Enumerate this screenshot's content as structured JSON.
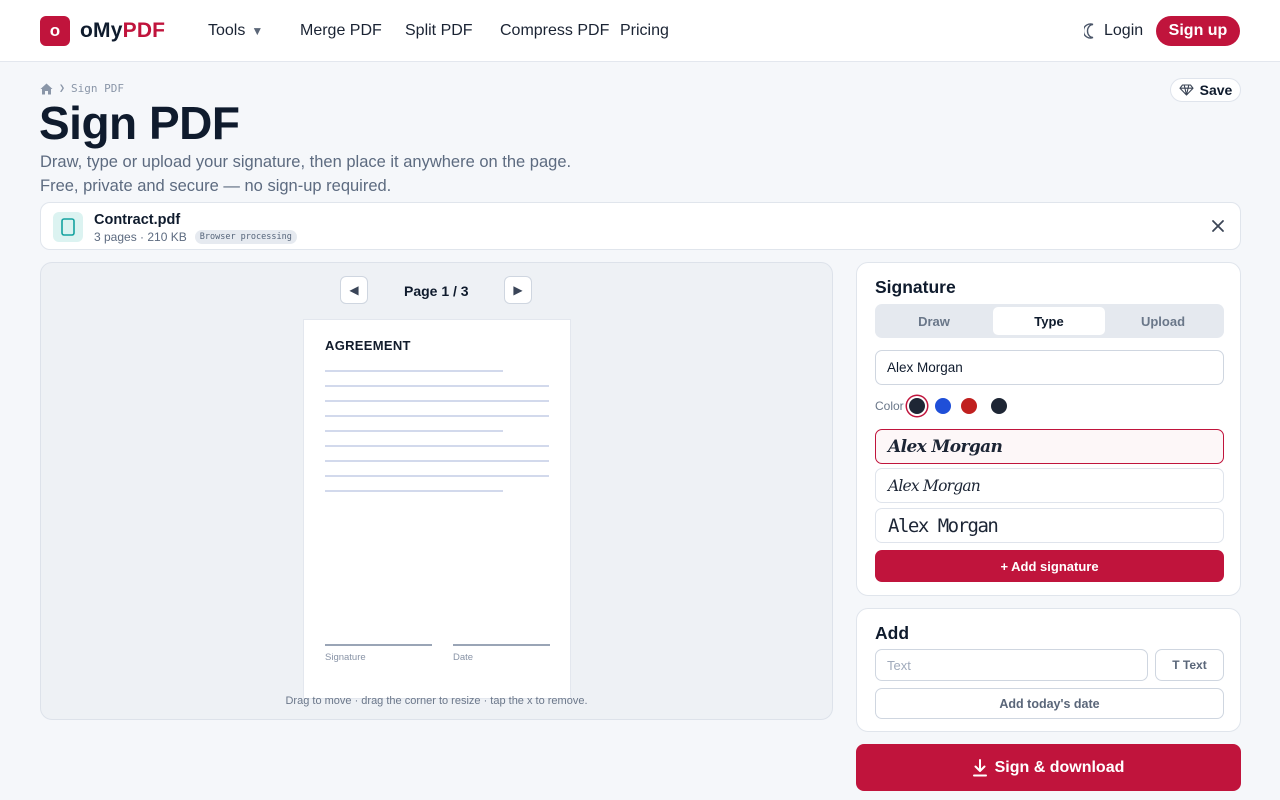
{
  "brand": {
    "logo_letter": "o",
    "name_part1": "oMy",
    "name_part2": "PDF",
    "accent_color": "#c0143c"
  },
  "nav": {
    "tools": "Tools",
    "merge": "Merge PDF",
    "split": "Split PDF",
    "compress": "Compress PDF",
    "pricing": "Pricing",
    "login": "Login",
    "signup": "Sign up"
  },
  "breadcrumb": {
    "current": "Sign PDF"
  },
  "page": {
    "title": "Sign PDF",
    "subtitle_line1": "Draw, type or upload your signature, then place it anywhere on the page.",
    "subtitle_line2": "Free, private and secure — no sign-up required.",
    "save_label": "Save"
  },
  "file": {
    "name": "Contract.pdf",
    "meta": "3 pages · 210 KB",
    "badge": "Browser processing"
  },
  "preview": {
    "page_label": "Page 1 / 3",
    "doc_title": "AGREEMENT",
    "signature_caption": "Signature",
    "date_caption": "Date",
    "hint": "Drag to move · drag the corner to resize · tap the x to remove."
  },
  "signature_panel": {
    "title": "Signature",
    "tabs": [
      {
        "label": "Draw",
        "active": false
      },
      {
        "label": "Type",
        "active": true
      },
      {
        "label": "Upload",
        "active": false
      }
    ],
    "name_value": "Alex Morgan",
    "color_label": "Color",
    "colors": [
      "#1e2635",
      "#1f4fd8",
      "#c0201f",
      "#1e2635"
    ],
    "selected_color_index": 0,
    "style_options": [
      "Alex Morgan",
      "Alex Morgan",
      "Alex Morgan"
    ],
    "selected_style_index": 0,
    "add_button": "+ Add signature"
  },
  "add_panel": {
    "title": "Add",
    "text_placeholder": "Text",
    "text_button": "T Text",
    "date_button": "Add today's date"
  },
  "download_button": "Sign & download"
}
